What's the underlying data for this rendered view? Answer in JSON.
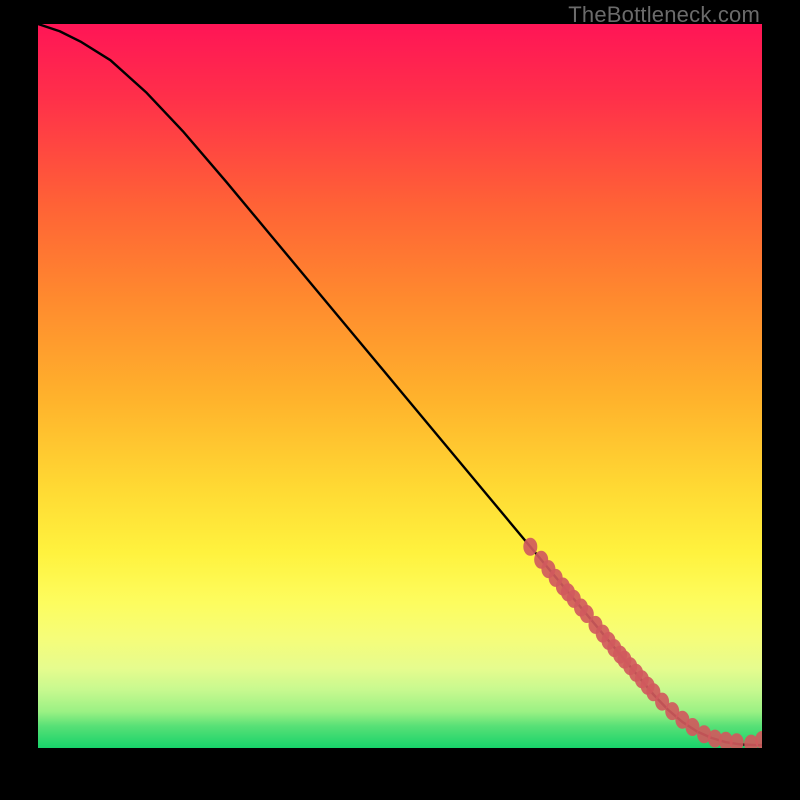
{
  "watermark": "TheBottleneck.com",
  "chart_data": {
    "type": "line",
    "title": "",
    "xlabel": "",
    "ylabel": "",
    "xlim": [
      0,
      100
    ],
    "ylim": [
      0,
      100
    ],
    "series": [
      {
        "name": "curve",
        "style": "line",
        "color": "#000000",
        "x": [
          0,
          3,
          6,
          10,
          15,
          20,
          26,
          32,
          38,
          44,
          50,
          56,
          62,
          68,
          72,
          76,
          80,
          83,
          85,
          87,
          89,
          91,
          93,
          95,
          97,
          99,
          100
        ],
        "y": [
          100,
          99,
          97.5,
          95,
          90.5,
          85.2,
          78.2,
          71,
          63.8,
          56.6,
          49.4,
          42.2,
          35,
          27.8,
          23,
          18.2,
          13.4,
          9.8,
          7.4,
          5.3,
          3.6,
          2.3,
          1.4,
          0.8,
          0.5,
          0.4,
          0.4
        ]
      },
      {
        "name": "markers",
        "style": "scatter",
        "color": "#d05a5d",
        "x": [
          68,
          69.5,
          70.5,
          71.5,
          72.5,
          73.2,
          74,
          75,
          75.8,
          77,
          78,
          78.8,
          79.6,
          80.4,
          81,
          81.8,
          82.6,
          83.4,
          84.2,
          85,
          86.2,
          87.6,
          89,
          90.4,
          92,
          93.5,
          95,
          96.5,
          98.5,
          100
        ],
        "y": [
          27.8,
          26,
          24.7,
          23.5,
          22.3,
          21.5,
          20.6,
          19.4,
          18.5,
          17,
          15.8,
          14.8,
          13.8,
          12.9,
          12.2,
          11.3,
          10.4,
          9.5,
          8.6,
          7.7,
          6.4,
          5.1,
          3.9,
          2.9,
          1.9,
          1.3,
          1.0,
          0.8,
          0.6,
          1.1
        ]
      }
    ]
  }
}
